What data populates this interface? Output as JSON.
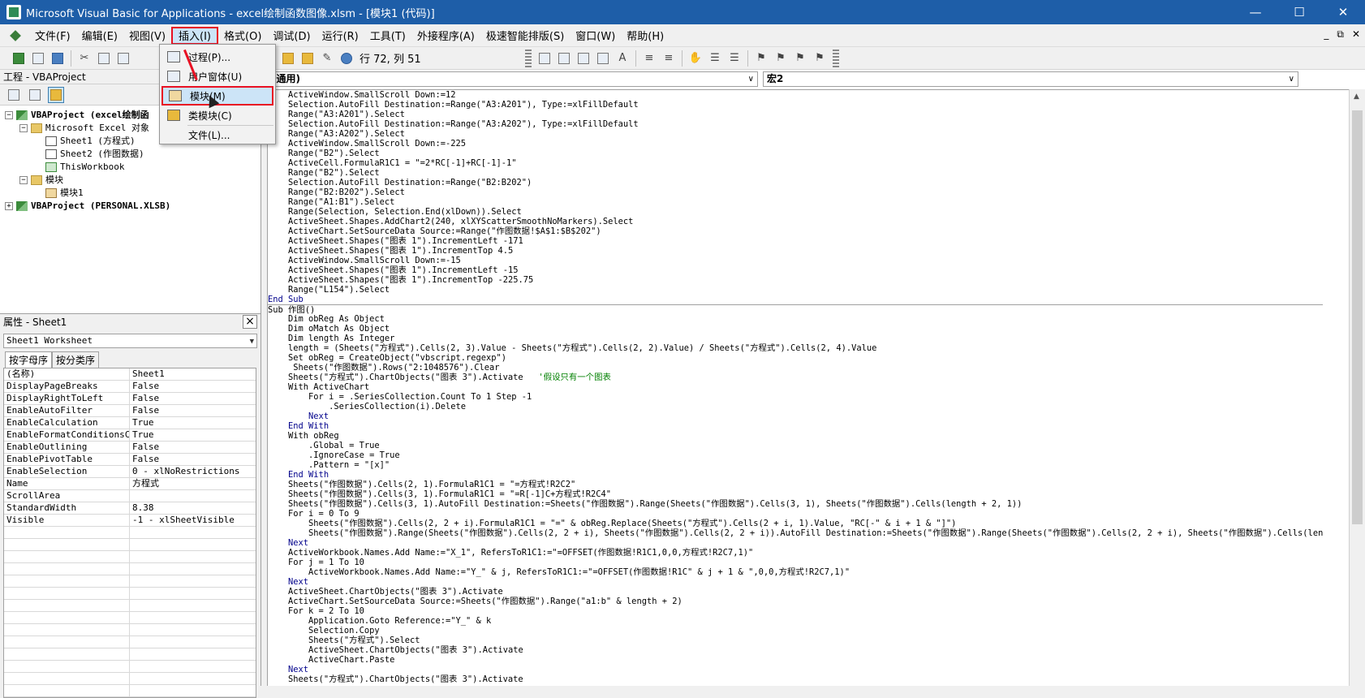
{
  "window": {
    "title": "Microsoft Visual Basic for Applications - excel绘制函数图像.xlsm - [模块1 (代码)]",
    "controls": [
      "—",
      "☐",
      "✕"
    ]
  },
  "menubar": {
    "items": [
      "文件(F)",
      "编辑(E)",
      "视图(V)",
      "插入(I)",
      "格式(O)",
      "调试(D)",
      "运行(R)",
      "工具(T)",
      "外接程序(A)",
      "极速智能排版(S)",
      "窗口(W)",
      "帮助(H)"
    ],
    "active_index": 3,
    "mdi_controls": [
      "_",
      "⧉",
      "✕"
    ]
  },
  "toolbar": {
    "cursor_position": "行 72, 列 51"
  },
  "insert_menu": {
    "items": [
      "过程(P)...",
      "用户窗体(U)",
      "模块(M)",
      "类模块(C)",
      "文件(L)..."
    ],
    "highlighted_index": 2
  },
  "project_panel": {
    "title": "工程 - VBAProject",
    "tree": [
      {
        "label": "VBAProject (excel绘制函",
        "level": 0,
        "expander": "−",
        "icon": "project",
        "bold": true
      },
      {
        "label": "Microsoft Excel 对象",
        "level": 1,
        "expander": "−",
        "icon": "folder"
      },
      {
        "label": "Sheet1 (方程式)",
        "level": 2,
        "icon": "sheet"
      },
      {
        "label": "Sheet2 (作图数据)",
        "level": 2,
        "icon": "sheet"
      },
      {
        "label": "ThisWorkbook",
        "level": 2,
        "icon": "book"
      },
      {
        "label": "模块",
        "level": 1,
        "expander": "−",
        "icon": "folder"
      },
      {
        "label": "模块1",
        "level": 2,
        "icon": "module"
      },
      {
        "label": "VBAProject (PERSONAL.XLSB)",
        "level": 0,
        "expander": "+",
        "icon": "project",
        "bold": true
      }
    ]
  },
  "properties_panel": {
    "title": "属性 - Sheet1",
    "object": "Sheet1 Worksheet",
    "tabs": [
      "按字母序",
      "按分类序"
    ],
    "rows": [
      {
        "name": "(名称)",
        "value": "Sheet1"
      },
      {
        "name": "DisplayPageBreaks",
        "value": "False"
      },
      {
        "name": "DisplayRightToLeft",
        "value": "False"
      },
      {
        "name": "EnableAutoFilter",
        "value": "False"
      },
      {
        "name": "EnableCalculation",
        "value": "True"
      },
      {
        "name": "EnableFormatConditionsCalc",
        "value": "True"
      },
      {
        "name": "EnableOutlining",
        "value": "False"
      },
      {
        "name": "EnablePivotTable",
        "value": "False"
      },
      {
        "name": "EnableSelection",
        "value": "0 - xlNoRestrictions"
      },
      {
        "name": "Name",
        "value": "方程式"
      },
      {
        "name": "ScrollArea",
        "value": ""
      },
      {
        "name": "StandardWidth",
        "value": "8.38"
      },
      {
        "name": "Visible",
        "value": "-1 - xlSheetVisible"
      }
    ]
  },
  "code_window": {
    "object_selector": "(通用)",
    "procedure_selector": "宏2",
    "lines": [
      "    ActiveWindow.SmallScroll Down:=12",
      "    Selection.AutoFill Destination:=Range(\"A3:A201\"), Type:=xlFillDefault",
      "    Range(\"A3:A201\").Select",
      "    Selection.AutoFill Destination:=Range(\"A3:A202\"), Type:=xlFillDefault",
      "    Range(\"A3:A202\").Select",
      "    ActiveWindow.SmallScroll Down:=-225",
      "    Range(\"B2\").Select",
      "    ActiveCell.FormulaR1C1 = \"=2*RC[-1]+RC[-1]-1\"",
      "    Range(\"B2\").Select",
      "    Selection.AutoFill Destination:=Range(\"B2:B202\")",
      "    Range(\"B2:B202\").Select",
      "    Range(\"A1:B1\").Select",
      "    Range(Selection, Selection.End(xlDown)).Select",
      "    ActiveSheet.Shapes.AddChart2(240, xlXYScatterSmoothNoMarkers).Select",
      "    ActiveChart.SetSourceData Source:=Range(\"作图数据!$A$1:$B$202\")",
      "    ActiveSheet.Shapes(\"图表 1\").IncrementLeft -171",
      "    ActiveSheet.Shapes(\"图表 1\").IncrementTop 4.5",
      "    ActiveWindow.SmallScroll Down:=-15",
      "    ActiveSheet.Shapes(\"图表 1\").IncrementLeft -15",
      "    ActiveSheet.Shapes(\"图表 1\").IncrementTop -225.75",
      "    Range(\"L154\").Select",
      "End Sub",
      "Sub 作图()",
      "    Dim obReg As Object",
      "    Dim oMatch As Object",
      "    Dim length As Integer",
      "    length = (Sheets(\"方程式\").Cells(2, 3).Value - Sheets(\"方程式\").Cells(2, 2).Value) / Sheets(\"方程式\").Cells(2, 4).Value",
      "    Set obReg = CreateObject(\"vbscript.regexp\")",
      "     Sheets(\"作图数据\").Rows(\"2:1048576\").Clear",
      "    Sheets(\"方程式\").ChartObjects(\"图表 3\").Activate   '假设只有一个图表",
      "    With ActiveChart",
      "        For i = .SeriesCollection.Count To 1 Step -1",
      "            .SeriesCollection(i).Delete",
      "        Next",
      "    End With",
      "    With obReg",
      "        .Global = True",
      "        .IgnoreCase = True",
      "        .Pattern = \"[x]\"",
      "    End With",
      "    Sheets(\"作图数据\").Cells(2, 1).FormulaR1C1 = \"=方程式!R2C2\"",
      "    Sheets(\"作图数据\").Cells(3, 1).FormulaR1C1 = \"=R[-1]C+方程式!R2C4\"",
      "    Sheets(\"作图数据\").Cells(3, 1).AutoFill Destination:=Sheets(\"作图数据\").Range(Sheets(\"作图数据\").Cells(3, 1), Sheets(\"作图数据\").Cells(length + 2, 1))",
      "    For i = 0 To 9",
      "        Sheets(\"作图数据\").Cells(2, 2 + i).FormulaR1C1 = \"=\" & obReg.Replace(Sheets(\"方程式\").Cells(2 + i, 1).Value, \"RC[-\" & i + 1 & \"]\")",
      "        Sheets(\"作图数据\").Range(Sheets(\"作图数据\").Cells(2, 2 + i), Sheets(\"作图数据\").Cells(2, 2 + i)).AutoFill Destination:=Sheets(\"作图数据\").Range(Sheets(\"作图数据\").Cells(2, 2 + i), Sheets(\"作图数据\").Cells(len",
      "    Next",
      "    ActiveWorkbook.Names.Add Name:=\"X_1\", RefersToR1C1:=\"=OFFSET(作图数据!R1C1,0,0,方程式!R2C7,1)\"",
      "    For j = 1 To 10",
      "        ActiveWorkbook.Names.Add Name:=\"Y_\" & j, RefersToR1C1:=\"=OFFSET(作图数据!R1C\" & j + 1 & \",0,0,方程式!R2C7,1)\"",
      "    Next",
      "    ActiveSheet.ChartObjects(\"图表 3\").Activate",
      "    ActiveChart.SetSourceData Source:=Sheets(\"作图数据\").Range(\"a1:b\" & length + 2)",
      "    For k = 2 To 10",
      "        Application.Goto Reference:=\"Y_\" & k",
      "        Selection.Copy",
      "        Sheets(\"方程式\").Select",
      "        ActiveSheet.ChartObjects(\"图表 3\").Activate",
      "        ActiveChart.Paste",
      "    Next",
      "    Sheets(\"方程式\").ChartObjects(\"图表 3\").Activate"
    ],
    "separator_before_line": 21
  }
}
